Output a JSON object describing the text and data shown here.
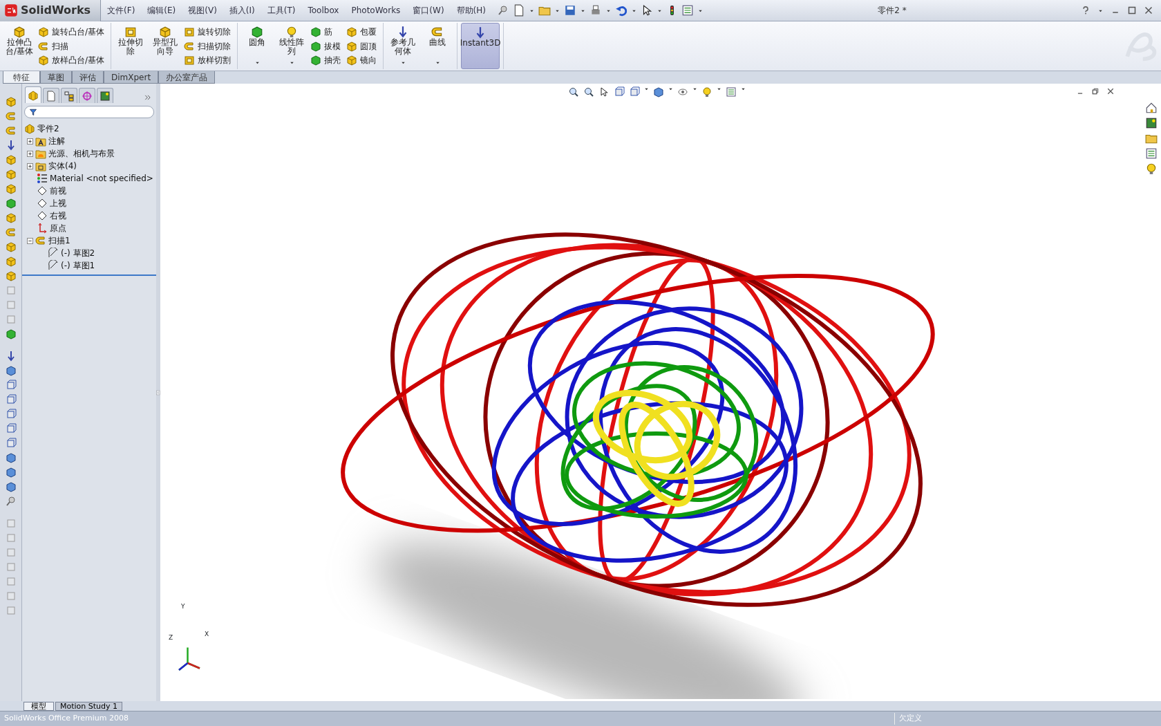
{
  "app": {
    "logo": "SolidWorks"
  },
  "menu": [
    "文件(F)",
    "编辑(E)",
    "视图(V)",
    "插入(I)",
    "工具(T)",
    "Toolbox",
    "PhotoWorks",
    "窗口(W)",
    "帮助(H)"
  ],
  "document_title": "零件2 *",
  "ribbon": {
    "groups": [
      {
        "large": [
          {
            "label": "拉伸凸台/基体",
            "dropdown": false
          }
        ],
        "small": [
          [
            "旋转凸台/基体",
            "扫描",
            "放样凸台/基体"
          ]
        ]
      },
      {
        "large": [
          {
            "label": "拉伸切除",
            "dropdown": false
          },
          {
            "label": "异型孔向导",
            "dropdown": false
          }
        ],
        "small": [
          [
            "旋转切除",
            "扫描切除",
            "放样切割"
          ]
        ]
      },
      {
        "large": [
          {
            "label": "圆角",
            "dropdown": true
          },
          {
            "label": "线性阵列",
            "dropdown": true
          }
        ],
        "small": [
          [
            "筋",
            "拔模",
            "抽壳"
          ],
          [
            "包覆",
            "圆顶",
            "镜向"
          ]
        ]
      },
      {
        "large": [
          {
            "label": "参考几何体",
            "dropdown": true
          },
          {
            "label": "曲线",
            "dropdown": true
          }
        ]
      },
      {
        "large": [
          {
            "label": "Instant3D",
            "dropdown": false,
            "selected": true
          }
        ]
      }
    ]
  },
  "tabs": [
    {
      "label": "特征",
      "selected": true
    },
    {
      "label": "草图",
      "selected": false
    },
    {
      "label": "评估",
      "selected": false
    },
    {
      "label": "DimXpert",
      "selected": false
    },
    {
      "label": "办公室产品",
      "selected": false
    }
  ],
  "panel_tabs": [
    {
      "selected": true
    },
    {
      "selected": false
    },
    {
      "selected": false
    },
    {
      "selected": false
    },
    {
      "selected": false
    }
  ],
  "tree": [
    {
      "label": "零件2",
      "kind": "part",
      "children": [
        {
          "label": "注解",
          "kind": "annotation",
          "expanded": false
        },
        {
          "label": "光源、相机与布景",
          "kind": "lights",
          "expanded": false
        },
        {
          "label": "实体(4)",
          "kind": "solid",
          "expanded": false
        },
        {
          "label": "Material <not specified>",
          "kind": "material"
        },
        {
          "label": "前视",
          "kind": "plane"
        },
        {
          "label": "上视",
          "kind": "plane"
        },
        {
          "label": "右视",
          "kind": "plane"
        },
        {
          "label": "原点",
          "kind": "origin"
        },
        {
          "label": "扫描1",
          "kind": "sweep",
          "expanded": true,
          "children": [
            {
              "label": "(-) 草图2",
              "kind": "sketch"
            },
            {
              "label": "(-) 草图1",
              "kind": "sketch"
            }
          ]
        }
      ]
    }
  ],
  "triad": [
    "Y",
    "X",
    "Z"
  ],
  "bottom_tabs": [
    {
      "label": "模型",
      "selected": true
    },
    {
      "label": "Motion Study 1",
      "selected": false
    }
  ],
  "status_bar": {
    "product": "SolidWorks Office Premium 2008",
    "state": "欠定义"
  }
}
